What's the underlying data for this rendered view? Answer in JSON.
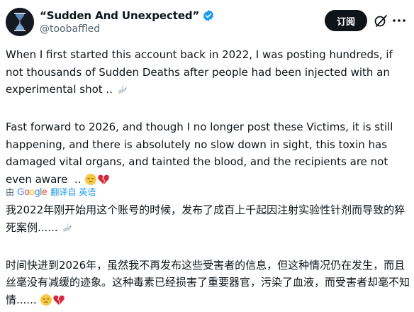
{
  "author": {
    "display_name": "“Sudden And Unexpected”",
    "handle": "@toobaffled"
  },
  "actions": {
    "subscribe_label": "订阅"
  },
  "icons": {
    "verified": "verified-badge-icon",
    "grok": "grok-icon",
    "more": "more-options-icon",
    "dove": "dove-icon",
    "pensive": "pensive-face-emoji",
    "broken_heart": "broken-heart-emoji"
  },
  "colors": {
    "verified_blue": "#1d9bf0",
    "text": "#0f1419",
    "secondary": "#536471",
    "link": "#1d9bf0"
  },
  "tweet": {
    "para1": "When I first started this account back in 2022, I was posting hundreds, if not thousands of Sudden Deaths after people had been injected with an experimental shot .. ",
    "para2": "Fast forward to 2026, and though I no longer post these Victims, it is still happening, and there is absolutely no slow down in sight, this toxin has damaged vital organs, and tainted the blood, and the recipients are not even aware  .. "
  },
  "translation": {
    "by_label": "由",
    "provider": "Google",
    "link_label": "翻译自 英语",
    "para1": "我2022年刚开始用这个账号的时候，发布了成百上千起因注射实验性针剂而导致的猝死案例...... ",
    "para2": "时间快进到2026年，虽然我不再发布这些受害者的信息，但这种情况仍在发生，而且丝毫没有减缓的迹象。这种毒素已经损害了重要器官，污染了血液，而受害者却毫不知情...... "
  }
}
